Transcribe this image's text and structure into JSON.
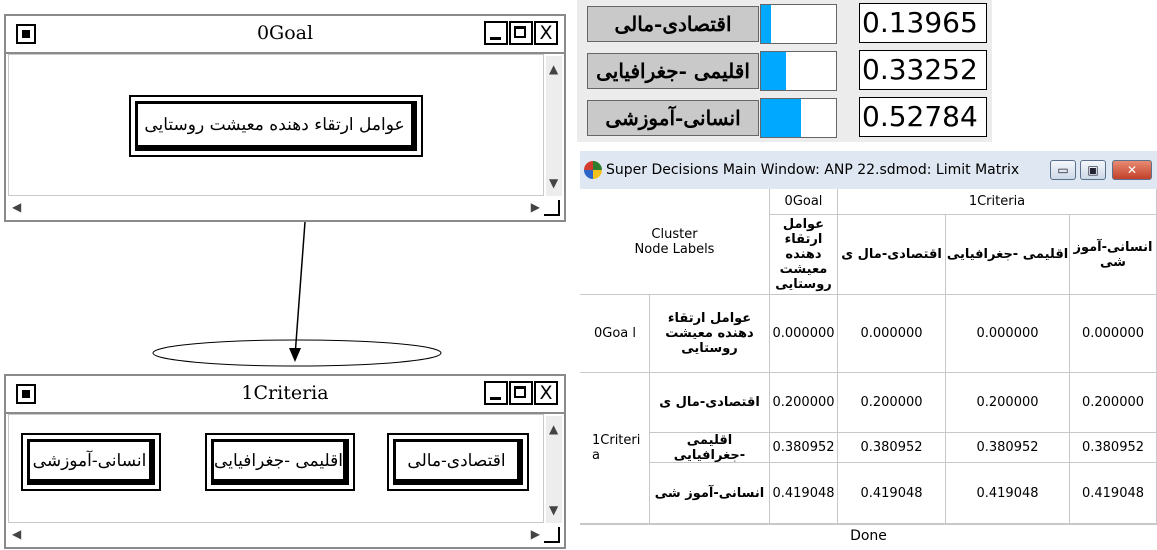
{
  "goal_window": {
    "title": "0Goal",
    "close_glyph": "X",
    "node_label": "عوامل ارتقاء دهنده معیشت روستایی",
    "scroll_up": "▲",
    "scroll_down": "▼",
    "scroll_left": "◀",
    "scroll_right": "▶"
  },
  "criteria_window": {
    "title": "1Criteria",
    "close_glyph": "X",
    "nodes": [
      "انسانی-آموزشی",
      "اقلیمی -جغرافیایی",
      "اقتصادی-مالی"
    ],
    "scroll_up": "▲",
    "scroll_down": "▼",
    "scroll_left": "◀",
    "scroll_right": "▶"
  },
  "results": [
    {
      "label": "اقتصادی-مالی",
      "value": "0.13965",
      "bar": 0.13965
    },
    {
      "label": "اقلیمی -جغرافیایی",
      "value": "0.33252",
      "bar": 0.33252
    },
    {
      "label": "انسانی-آموزشی",
      "value": "0.52784",
      "bar": 0.52784
    }
  ],
  "limit_window": {
    "title": "Super Decisions Main Window: ANP 22.sdmod: Limit Matrix",
    "min_glyph": "▭",
    "max_glyph": "▣",
    "close_glyph": "✕",
    "header_cluster_label": "Cluster\nNode Labels",
    "col_clusters": [
      "0Goal",
      "1Criteria"
    ],
    "col_nodes": [
      "عوامل ارتقاء دهنده معیشت روستایی",
      "اقتصادی-مال ی",
      "اقلیمی -جغرافیایی",
      "انسانی-آموز شی"
    ],
    "row_clusters": [
      "0Goa l",
      "1Criteri a"
    ],
    "row_nodes": [
      "عوامل ارتقاء دهنده معیشت روستایی",
      "اقتصادی-مال ی",
      "اقلیمی -جغرافیایی",
      "انسانی-آموز شی"
    ],
    "values": [
      [
        "0.000000",
        "0.000000",
        "0.000000",
        "0.000000"
      ],
      [
        "0.200000",
        "0.200000",
        "0.200000",
        "0.200000"
      ],
      [
        "0.380952",
        "0.380952",
        "0.380952",
        "0.380952"
      ],
      [
        "0.419048",
        "0.419048",
        "0.419048",
        "0.419048"
      ]
    ],
    "status": "Done"
  },
  "colors": {
    "bar_fill": "#00a8ff",
    "titlebar": "#dfe7f2"
  }
}
